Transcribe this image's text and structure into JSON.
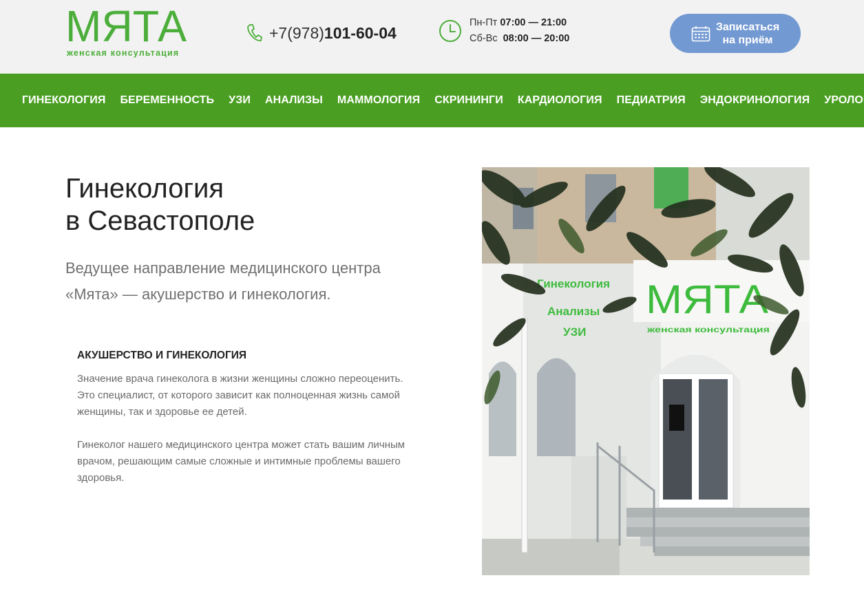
{
  "header": {
    "logo": {
      "name": "МЯТА",
      "subtitle": "женская консультация"
    },
    "phone": {
      "prefix": "+7(978)",
      "number": "101-60-04"
    },
    "hours": {
      "weekdays_label": "Пн-Пт",
      "weekdays_time": "07:00 — 21:00",
      "weekend_label": "Сб-Вс",
      "weekend_time": "08:00 — 20:00"
    },
    "cta_label": "Записаться\nна приём"
  },
  "nav": {
    "items": [
      "ГИНЕКОЛОГИЯ",
      "БЕРЕМЕННОСТЬ",
      "УЗИ",
      "АНАЛИЗЫ",
      "МАММОЛОГИЯ",
      "СКРИНИНГИ",
      "КАРДИОЛОГИЯ",
      "ПЕДИАТРИЯ",
      "ЭНДОКРИНОЛОГИЯ",
      "УРОЛОГ"
    ]
  },
  "hero": {
    "title": "Гинекология\nв Севастополе",
    "lead": "Ведущее направление медицинского центра «Мята» — акушерство и гинекология."
  },
  "section": {
    "heading": "АКУШЕРСТВО И ГИНЕКОЛОГИЯ",
    "paragraph_1": "Значение врача гинеколога в жизни женщины сложно переоценить. Это специалист, от которого зависит как полноценная жизнь самой женщины, так и здоровье ее детей.",
    "paragraph_2": "Гинеколог нашего медицинского центра может стать вашим личным врачом, решающим самые сложные и интимные проблемы вашего здоровья."
  },
  "photo": {
    "sign_name": "МЯТА",
    "sign_subtitle": "женская консультация",
    "vertical_signs": [
      "Гинекология",
      "Анализы",
      "УЗИ"
    ]
  },
  "colors": {
    "brand_green": "#4a9f22",
    "logo_green": "#4cae3a",
    "cta_blue": "#7399d3",
    "header_bg": "#f2f2f2"
  },
  "icons": [
    "phone-icon",
    "clock-icon",
    "calendar-icon"
  ]
}
